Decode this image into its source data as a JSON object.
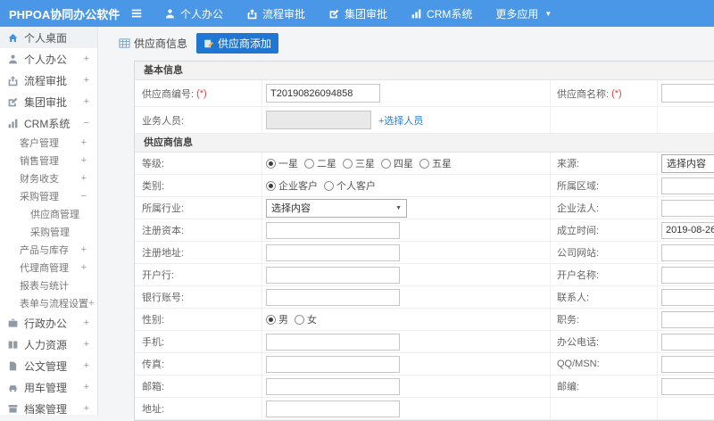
{
  "colors": {
    "topbar_blue": "#4a97e8",
    "active_tab_blue": "#2077d3",
    "link_blue": "#2a7ed8",
    "required_red": "#e34343"
  },
  "topbar": {
    "logo": "PHPOA协同办公软件",
    "nav": [
      {
        "label": "个人办公"
      },
      {
        "label": "流程审批"
      },
      {
        "label": "集团审批"
      },
      {
        "label": "CRM系统"
      },
      {
        "label": "更多应用"
      }
    ]
  },
  "tabs": [
    {
      "label": "供应商信息",
      "active": false
    },
    {
      "label": "供应商添加",
      "active": true
    }
  ],
  "sidebar": {
    "items": [
      {
        "label": "个人桌面",
        "sign": "",
        "active": true
      },
      {
        "label": "个人办公",
        "sign": "+"
      },
      {
        "label": "流程审批",
        "sign": "+"
      },
      {
        "label": "集团审批",
        "sign": "+"
      },
      {
        "label": "CRM系统",
        "sign": "−"
      },
      {
        "label": "客户管理",
        "sign": "+"
      },
      {
        "label": "销售管理",
        "sign": "+"
      },
      {
        "label": "财务收支",
        "sign": "+"
      },
      {
        "label": "采购管理",
        "sign": "−"
      },
      {
        "label": "供应商管理",
        "sign": ""
      },
      {
        "label": "采购管理",
        "sign": ""
      },
      {
        "label": "产品与库存",
        "sign": "+"
      },
      {
        "label": "代理商管理",
        "sign": "+"
      },
      {
        "label": "报表与统计",
        "sign": ""
      },
      {
        "label": "表单与流程设置",
        "sign": "+"
      },
      {
        "label": "行政办公",
        "sign": "+"
      },
      {
        "label": "人力资源",
        "sign": "+"
      },
      {
        "label": "公文管理",
        "sign": "+"
      },
      {
        "label": "用车管理",
        "sign": "+"
      },
      {
        "label": "档案管理",
        "sign": "+"
      }
    ]
  },
  "form": {
    "basic": {
      "title": "基本信息",
      "supplier_no": {
        "label": "供应商编号:",
        "required": "(*)",
        "value": "T20190826094858"
      },
      "supplier_name": {
        "label": "供应商名称:",
        "required": "(*)",
        "value": ""
      },
      "staff": {
        "label": "业务人员:",
        "value": "",
        "link": "+选择人员"
      }
    },
    "info": {
      "title": "供应商信息",
      "level": {
        "label": "等级:",
        "options": [
          {
            "label": "一星",
            "selected": true
          },
          {
            "label": "二星",
            "selected": false
          },
          {
            "label": "三星",
            "selected": false
          },
          {
            "label": "四星",
            "selected": false
          },
          {
            "label": "五星",
            "selected": false
          }
        ]
      },
      "source": {
        "label": "来源:",
        "placeholder": "选择内容"
      },
      "category": {
        "label": "类别:",
        "options": [
          {
            "label": "企业客户",
            "selected": true
          },
          {
            "label": "个人客户",
            "selected": false
          }
        ]
      },
      "region": {
        "label": "所属区域:",
        "value": ""
      },
      "industry": {
        "label": "所属行业:",
        "placeholder": "选择内容"
      },
      "legal_person": {
        "label": "企业法人:",
        "value": ""
      },
      "registered_capital": {
        "label": "注册资本:",
        "value": ""
      },
      "founded_date": {
        "label": "成立时间:",
        "value": "2019-08-26"
      },
      "registered_address": {
        "label": "注册地址:",
        "value": ""
      },
      "website": {
        "label": "公司网站:",
        "value": ""
      },
      "bank": {
        "label": "开户行:",
        "value": ""
      },
      "account_name": {
        "label": "开户名称:",
        "value": ""
      },
      "bank_account": {
        "label": "银行账号:",
        "value": ""
      },
      "contact": {
        "label": "联系人:",
        "value": ""
      },
      "gender": {
        "label": "性别:",
        "options": [
          {
            "label": "男",
            "selected": true
          },
          {
            "label": "女",
            "selected": false
          }
        ]
      },
      "position": {
        "label": "职务:",
        "value": ""
      },
      "mobile": {
        "label": "手机:",
        "value": ""
      },
      "office_phone": {
        "label": "办公电话:",
        "value": ""
      },
      "fax": {
        "label": "传真:",
        "value": ""
      },
      "qq_msn": {
        "label": "QQ/MSN:",
        "value": ""
      },
      "email": {
        "label": "邮箱:",
        "value": ""
      },
      "zip": {
        "label": "邮编:",
        "value": ""
      },
      "address": {
        "label": "地址:",
        "value": ""
      }
    }
  }
}
